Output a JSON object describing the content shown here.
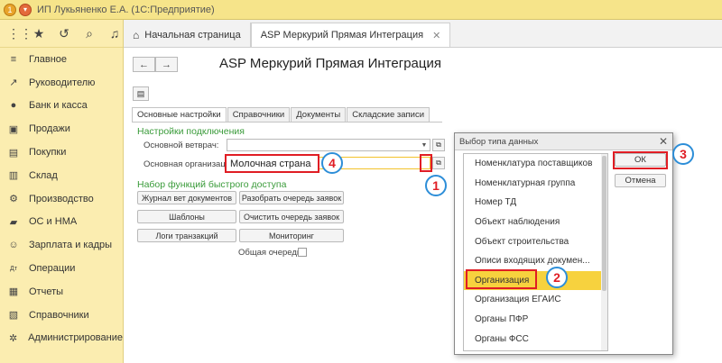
{
  "window": {
    "title": "ИП Лукьяненко Е.А.  (1С:Предприятие)"
  },
  "sidebar": {
    "items": [
      {
        "icon": "menu-icon",
        "label": "Главное"
      },
      {
        "icon": "chart-icon",
        "label": "Руководителю"
      },
      {
        "icon": "bank-icon",
        "label": "Банк и касса"
      },
      {
        "icon": "cart-icon",
        "label": "Продажи"
      },
      {
        "icon": "basket-icon",
        "label": "Покупки"
      },
      {
        "icon": "warehouse-icon",
        "label": "Склад"
      },
      {
        "icon": "factory-icon",
        "label": "Производство"
      },
      {
        "icon": "truck-icon",
        "label": "ОС и НМА"
      },
      {
        "icon": "people-icon",
        "label": "Зарплата и кадры"
      },
      {
        "icon": "dtkt-icon",
        "label": "Операции"
      },
      {
        "icon": "reports-icon",
        "label": "Отчеты"
      },
      {
        "icon": "book-icon",
        "label": "Справочники"
      },
      {
        "icon": "gear-icon",
        "label": "Администрирование"
      }
    ]
  },
  "tabs": [
    {
      "label": "Начальная страница"
    },
    {
      "label": "ASP Меркурий Прямая Интеграция"
    }
  ],
  "form": {
    "title": "ASP Меркурий Прямая Интеграция",
    "tabs": [
      "Основные настройки",
      "Справочники",
      "Документы",
      "Складские записи"
    ],
    "connection_group": "Настройки подключения",
    "vet_label": "Основной ветврач:",
    "vet_value": "",
    "org_label": "Основная организация:",
    "org_value": "Молочная страна",
    "quick_group": "Набор функций быстрого доступа",
    "buttons": [
      "Журнал вет документов",
      "Разобрать очередь заявок",
      "Шаблоны",
      "Очистить очередь заявок",
      "Логи транзакций",
      "Мониторинг"
    ],
    "queue_label": "Общая очередь:"
  },
  "dialog": {
    "title": "Выбор типа данных",
    "items": [
      "Номенклатура поставщиков",
      "Номенклатурная группа",
      "Номер ТД",
      "Объект наблюдения",
      "Объект строительства",
      "Описи входящих докумен...",
      "Организация",
      "Организация ЕГАИС",
      "Органы ПФР",
      "Органы ФСС"
    ],
    "selected": "Организация",
    "ok_label": "ОК",
    "cancel_label": "Отмена"
  },
  "callouts": [
    "1",
    "2",
    "3",
    "4"
  ],
  "colors": {
    "accent": "#f7d23e",
    "highlight": "#e01d24",
    "callout_ring": "#2d8ed8",
    "group_title": "#3a9b3a"
  }
}
